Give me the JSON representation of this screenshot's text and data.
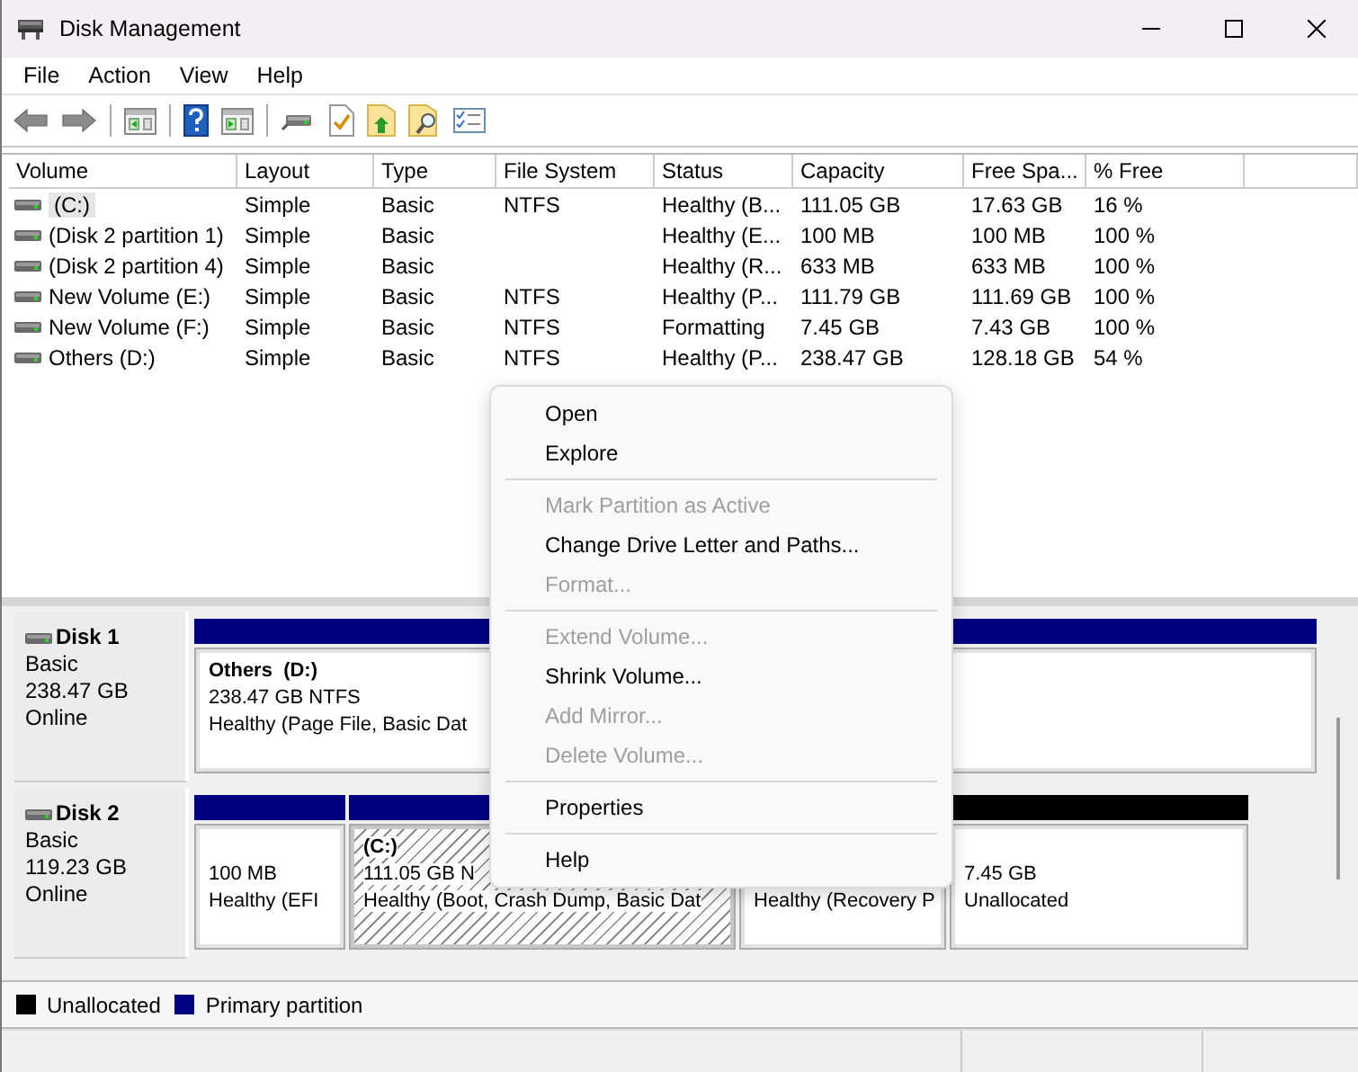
{
  "window": {
    "title": "Disk Management"
  },
  "menu_bar": [
    "File",
    "Action",
    "View",
    "Help"
  ],
  "volume_table": {
    "columns": [
      "Volume",
      "Layout",
      "Type",
      "File System",
      "Status",
      "Capacity",
      "Free Spa...",
      "% Free"
    ],
    "rows": [
      {
        "selected": true,
        "cells": [
          "(C:)",
          "Simple",
          "Basic",
          "NTFS",
          "Healthy (B...",
          "111.05 GB",
          "17.63 GB",
          "16 %"
        ]
      },
      {
        "selected": false,
        "cells": [
          "(Disk 2 partition 1)",
          "Simple",
          "Basic",
          "",
          "Healthy (E...",
          "100 MB",
          "100 MB",
          "100 %"
        ]
      },
      {
        "selected": false,
        "cells": [
          "(Disk 2 partition 4)",
          "Simple",
          "Basic",
          "",
          "Healthy (R...",
          "633 MB",
          "633 MB",
          "100 %"
        ]
      },
      {
        "selected": false,
        "cells": [
          "New Volume (E:)",
          "Simple",
          "Basic",
          "NTFS",
          "Healthy (P...",
          "111.79 GB",
          "111.69 GB",
          "100 %"
        ]
      },
      {
        "selected": false,
        "cells": [
          "New Volume (F:)",
          "Simple",
          "Basic",
          "NTFS",
          "Formatting",
          "7.45 GB",
          "7.43 GB",
          "100 %"
        ]
      },
      {
        "selected": false,
        "cells": [
          "Others (D:)",
          "Simple",
          "Basic",
          "NTFS",
          "Healthy (P...",
          "238.47 GB",
          "128.18 GB",
          "54 %"
        ]
      }
    ]
  },
  "disks": [
    {
      "name": "Disk 1",
      "type": "Basic",
      "size": "238.47 GB",
      "status": "Online",
      "partitions": [
        {
          "kind": "primary",
          "selected": false,
          "label": "Others  (D:)",
          "size": "238.47 GB NTFS",
          "status": "Healthy (Page File, Basic Dat"
        }
      ]
    },
    {
      "name": "Disk 2",
      "type": "Basic",
      "size": "119.23 GB",
      "status": "Online",
      "partitions": [
        {
          "kind": "primary",
          "selected": false,
          "size": "100 MB",
          "status": "Healthy (EFI"
        },
        {
          "kind": "primary",
          "selected": true,
          "label": "(C:)",
          "size": "111.05 GB N",
          "status": "Healthy (Boot, Crash Dump, Basic Dat"
        },
        {
          "selected": false,
          "status": "Healthy (Recovery P"
        },
        {
          "kind": "unallocated",
          "selected": false,
          "size": "7.45 GB",
          "status": "Unallocated"
        }
      ]
    }
  ],
  "legend": [
    {
      "label": "Unallocated",
      "color": "#000000"
    },
    {
      "label": "Primary partition",
      "color": "#000080"
    }
  ],
  "context_menu": [
    {
      "kind": "item",
      "label": "Open",
      "disabled": false
    },
    {
      "kind": "item",
      "label": "Explore",
      "disabled": false
    },
    {
      "kind": "separator"
    },
    {
      "kind": "item",
      "label": "Mark Partition as Active",
      "disabled": true
    },
    {
      "kind": "item",
      "label": "Change Drive Letter and Paths...",
      "disabled": false
    },
    {
      "kind": "item",
      "label": "Format...",
      "disabled": true
    },
    {
      "kind": "separator"
    },
    {
      "kind": "item",
      "label": "Extend Volume...",
      "disabled": true
    },
    {
      "kind": "item",
      "label": "Shrink Volume...",
      "disabled": false
    },
    {
      "kind": "item",
      "label": "Add Mirror...",
      "disabled": true
    },
    {
      "kind": "item",
      "label": "Delete Volume...",
      "disabled": true
    },
    {
      "kind": "separator"
    },
    {
      "kind": "item",
      "label": "Properties",
      "disabled": false
    },
    {
      "kind": "separator"
    },
    {
      "kind": "item",
      "label": "Help",
      "disabled": false
    }
  ]
}
